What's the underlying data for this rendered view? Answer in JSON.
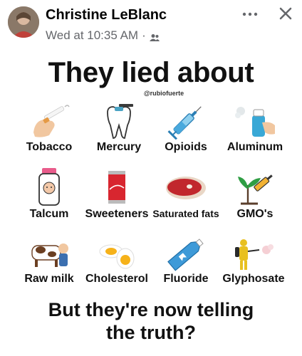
{
  "post": {
    "author": "Christine LeBlanc",
    "timestamp": "Wed at 10:35 AM",
    "separator": "·",
    "audience_icon": "friends-icon",
    "more_icon": "more-dots-icon",
    "close_icon": "close-icon"
  },
  "poster": {
    "title": "They lied about",
    "handle": "@rubiofuerte",
    "items": [
      {
        "label": "Tobacco",
        "icon": "cigarette-icon"
      },
      {
        "label": "Mercury",
        "icon": "tooth-icon"
      },
      {
        "label": "Opioids",
        "icon": "syringe-icon"
      },
      {
        "label": "Aluminum",
        "icon": "spray-can-icon"
      },
      {
        "label": "Talcum",
        "icon": "baby-powder-icon"
      },
      {
        "label": "Sweeteners",
        "icon": "soda-can-icon"
      },
      {
        "label": "Saturated fats",
        "icon": "steak-icon"
      },
      {
        "label": "GMO's",
        "icon": "plant-syringe-icon"
      },
      {
        "label": "Raw milk",
        "icon": "cow-icon"
      },
      {
        "label": "Cholesterol",
        "icon": "eggs-icon"
      },
      {
        "label": "Fluoride",
        "icon": "toothpaste-icon"
      },
      {
        "label": "Glyphosate",
        "icon": "sprayer-person-icon"
      }
    ],
    "footer_line1": "But they're now telling",
    "footer_line2": "the truth?"
  }
}
